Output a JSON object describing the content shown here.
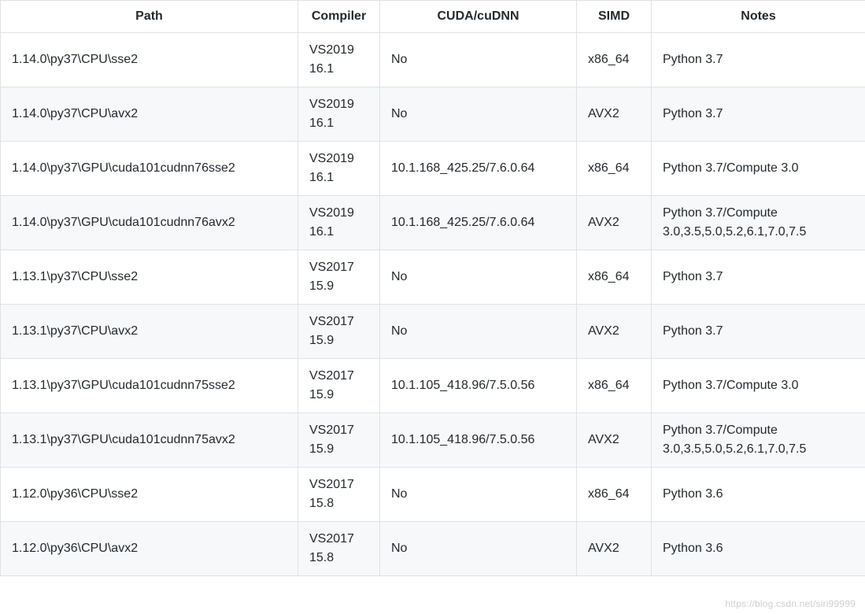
{
  "table": {
    "headers": {
      "path": "Path",
      "compiler": "Compiler",
      "cuda": "CUDA/cuDNN",
      "simd": "SIMD",
      "notes": "Notes"
    },
    "rows": [
      {
        "path": "1.14.0\\py37\\CPU\\sse2",
        "compiler": "VS2019 16.1",
        "cuda": "No",
        "simd": "x86_64",
        "notes": "Python 3.7"
      },
      {
        "path": "1.14.0\\py37\\CPU\\avx2",
        "compiler": "VS2019 16.1",
        "cuda": "No",
        "simd": "AVX2",
        "notes": "Python 3.7"
      },
      {
        "path": "1.14.0\\py37\\GPU\\cuda101cudnn76sse2",
        "compiler": "VS2019 16.1",
        "cuda": "10.1.168_425.25/7.6.0.64",
        "simd": "x86_64",
        "notes": "Python 3.7/Compute 3.0"
      },
      {
        "path": "1.14.0\\py37\\GPU\\cuda101cudnn76avx2",
        "compiler": "VS2019 16.1",
        "cuda": "10.1.168_425.25/7.6.0.64",
        "simd": "AVX2",
        "notes": "Python 3.7/Compute 3.0,3.5,5.0,5.2,6.1,7.0,7.5"
      },
      {
        "path": "1.13.1\\py37\\CPU\\sse2",
        "compiler": "VS2017 15.9",
        "cuda": "No",
        "simd": "x86_64",
        "notes": "Python 3.7"
      },
      {
        "path": "1.13.1\\py37\\CPU\\avx2",
        "compiler": "VS2017 15.9",
        "cuda": "No",
        "simd": "AVX2",
        "notes": "Python 3.7"
      },
      {
        "path": "1.13.1\\py37\\GPU\\cuda101cudnn75sse2",
        "compiler": "VS2017 15.9",
        "cuda": "10.1.105_418.96/7.5.0.56",
        "simd": "x86_64",
        "notes": "Python 3.7/Compute 3.0"
      },
      {
        "path": "1.13.1\\py37\\GPU\\cuda101cudnn75avx2",
        "compiler": "VS2017 15.9",
        "cuda": "10.1.105_418.96/7.5.0.56",
        "simd": "AVX2",
        "notes": "Python 3.7/Compute 3.0,3.5,5.0,5.2,6.1,7.0,7.5"
      },
      {
        "path": "1.12.0\\py36\\CPU\\sse2",
        "compiler": "VS2017 15.8",
        "cuda": "No",
        "simd": "x86_64",
        "notes": "Python 3.6"
      },
      {
        "path": "1.12.0\\py36\\CPU\\avx2",
        "compiler": "VS2017 15.8",
        "cuda": "No",
        "simd": "AVX2",
        "notes": "Python 3.6"
      }
    ]
  },
  "watermark": "https://blog.csdn.net/siri99999"
}
